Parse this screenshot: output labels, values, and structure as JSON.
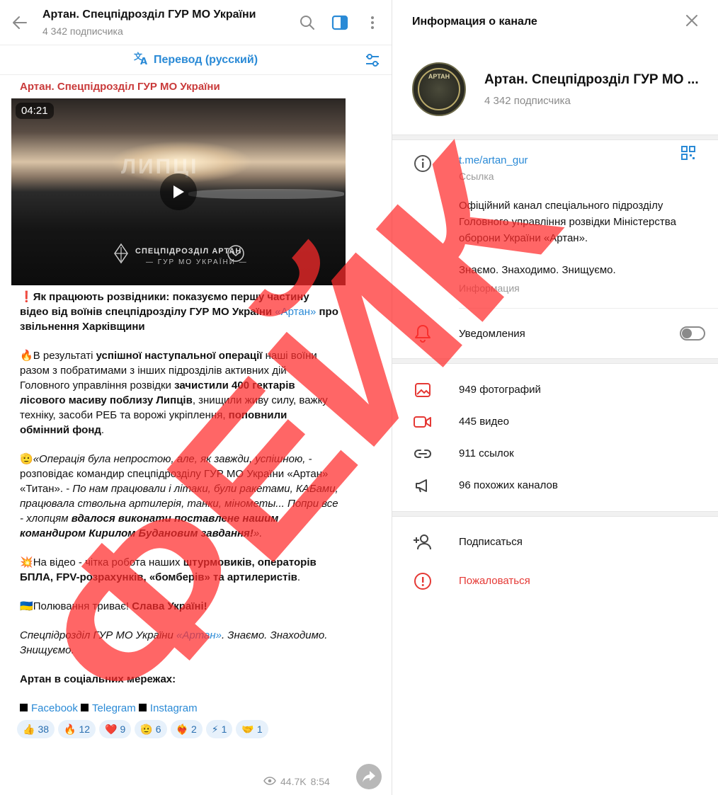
{
  "chat": {
    "title": "Артан. Спецпідрозділ ГУР МО України",
    "subscribers": "4 342 подписчика",
    "translate_label": "Перевод (русский)"
  },
  "message": {
    "author": "Артан. Спецпідрозділ ГУР МО України",
    "video": {
      "duration": "04:21",
      "overlay_title": "ЛИПЦІ",
      "brand_line1": "СПЕЦПІДРОЗДІЛ АРТАН",
      "brand_line2": "— ГУР МО УКРАЇНИ —"
    },
    "p1_emoji": "❗",
    "p1_a": "Як працюють розвідники: показуємо першу частину відео від воїнів спецпідрозділу ГУР МО України ",
    "p1_link": "«Артан»",
    "p1_b": " про звільнення Харківщини",
    "p2_emoji": "🔥",
    "p2_a": "В результаті ",
    "p2_b": "успішної наступальної операції",
    "p2_c": " наші воїни разом з побратимами з інших підрозділів активних дій Головного управління розвідки ",
    "p2_d": "зачистили 400 гектарів лісового масиву поблизу Липців",
    "p2_e": ", знищили живу силу, важку техніку, засоби РЕБ та ворожі укріплення, ",
    "p2_f": "поповнили обмінний фонд",
    "p2_g": ".",
    "p3_emoji": "🫡",
    "p3_a": "«Операція була непростою, але, як завжди, успішною, -",
    "p3_b": " розповідає командир спецпідрозділу ГУР МО України «Артан» «Титан». - ",
    "p3_c": "По нам працювали і літаки, були ракетами, КАБами, працювала ствольна артилерія, танки, мінометы...  Попри все - хлопцям ",
    "p3_d": "вдалося виконати поставлене нашим командиром Кирилом Будановим завдання!",
    "p3_e": "».",
    "p4_emoji": "💥",
    "p4_a": "На відео - чітка робота наших ",
    "p4_b": "штурмовиків, операторів БПЛА, FPV-розрахунків, «бомберів» та артилеристів",
    "p4_c": ".",
    "p5_emoji": "🇺🇦",
    "p5_a": "Полювання триває! ",
    "p5_b": "Слава Україні!",
    "p6_a": "Спецпідрозділ ГУР МО України ",
    "p6_link": "«Артан»",
    "p6_b": ". Знаємо. Знаходимо. Знищуємо.",
    "social_title": "Артан в соціальних мережах:",
    "social": [
      "Facebook",
      "Telegram",
      "Instagram"
    ],
    "reactions": [
      {
        "emoji": "👍",
        "count": "38"
      },
      {
        "emoji": "🔥",
        "count": "12"
      },
      {
        "emoji": "❤️",
        "count": "9"
      },
      {
        "emoji": "🫡",
        "count": "6"
      },
      {
        "emoji": "❤️‍🔥",
        "count": "2"
      },
      {
        "emoji": "⚡",
        "count": "1"
      },
      {
        "emoji": "🤝",
        "count": "1"
      }
    ],
    "views": "44.7K",
    "time": "8:54"
  },
  "info_panel": {
    "header": "Информация о канале",
    "name": "Артан. Спецпідрозділ ГУР МО ...",
    "subscribers": "4 342 подписчика",
    "avatar_text": "АРТАН",
    "link": "t.me/artan_gur",
    "link_caption": "Ссылка",
    "description": "Офіційний канал спеціального підрозділу Головного управління розвідки Міністерства оборони України «Артан».",
    "slogan": "Знаємо. Знаходимо. Знищуємо.",
    "desc_caption": "Информация",
    "notifications_label": "Уведомления",
    "notifications_on": false,
    "media": [
      {
        "icon": "photo-icon",
        "label": "949 фотографий"
      },
      {
        "icon": "video-icon",
        "label": "445 видео"
      },
      {
        "icon": "link-icon",
        "label": "911 ссылок"
      },
      {
        "icon": "megaphone-icon",
        "label": "96 похожих каналов"
      }
    ],
    "subscribe_label": "Подписаться",
    "report_label": "Пожаловаться"
  },
  "watermark": {
    "text": "ФЕЙК",
    "color": "#ff2b2b"
  },
  "colors": {
    "accent": "#2a8ad6",
    "icon_red": "#e53935",
    "author_red": "#c93a3a"
  }
}
